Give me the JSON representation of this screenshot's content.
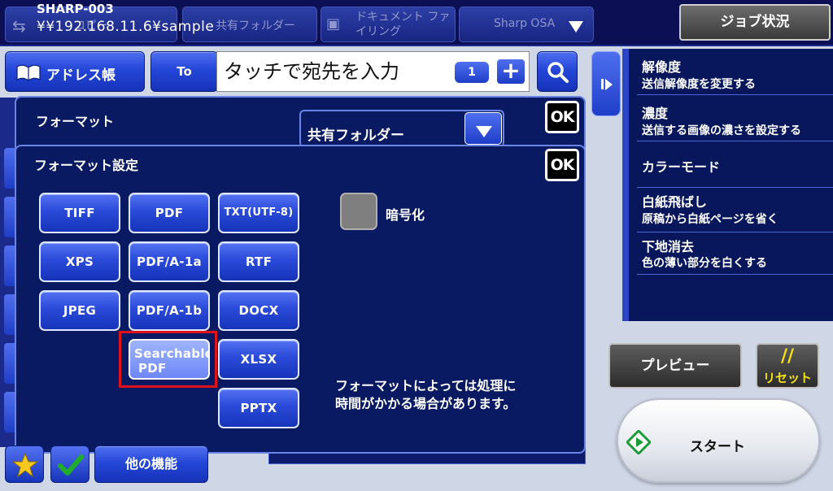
{
  "header": {
    "device_name": "SHARP-003",
    "device_path": "¥¥192.168.11.6¥sample",
    "tabs": [
      {
        "label": "コピー"
      },
      {
        "label": "共有フォルダー"
      },
      {
        "label": "ドキュメント ファイリング"
      },
      {
        "label": "Sharp OSA"
      }
    ],
    "job_status": "ジョブ状況"
  },
  "address": {
    "book_label": "アドレス帳",
    "to_label": "To",
    "dest_placeholder": "タッチで宛先を入力",
    "count": "1",
    "plus": "+"
  },
  "format_dialog": {
    "title": "フォーマット",
    "ok": "OK",
    "destination_type": "共有フォルダー"
  },
  "format_settings": {
    "title": "フォーマット設定",
    "ok": "OK",
    "formats": [
      {
        "label": "TIFF"
      },
      {
        "label": "PDF"
      },
      {
        "label": "TXT(UTF-8)"
      },
      {
        "label": "XPS"
      },
      {
        "label": "PDF/A-1a"
      },
      {
        "label": "RTF"
      },
      {
        "label": "JPEG"
      },
      {
        "label": "PDF/A-1b"
      },
      {
        "label": "DOCX"
      },
      {
        "label": "Searchable PDF",
        "line1": "Searchable",
        "line2": "PDF",
        "selected": true
      },
      {
        "label": "XLSX"
      },
      {
        "label": "PPTX"
      }
    ],
    "encrypt_label": "暗号化",
    "note_line1": "フォーマットによっては処理に",
    "note_line2": "時間がかかる場合があります。"
  },
  "bottom": {
    "other_functions": "他の機能",
    "star_icon": "star-icon",
    "check_icon": "checkmark-icon"
  },
  "side_panel": {
    "items": [
      {
        "title": "解像度",
        "subtitle": "送信解像度を変更する"
      },
      {
        "title": "濃度",
        "subtitle": "送信する画像の濃さを設定する"
      },
      {
        "title": "カラーモード",
        "subtitle": ""
      },
      {
        "title": "白紙飛ばし",
        "subtitle": "原稿から白紙ページを省く"
      },
      {
        "title": "下地消去",
        "subtitle": "色の薄い部分を白くする"
      }
    ]
  },
  "actions": {
    "preview": "プレビュー",
    "reset": "リセット",
    "start": "スタート"
  },
  "colors": {
    "accent": "#2547d8",
    "panel": "#0a1a62",
    "selected_outline": "#e0121a",
    "reset_text": "#f5e21a"
  }
}
